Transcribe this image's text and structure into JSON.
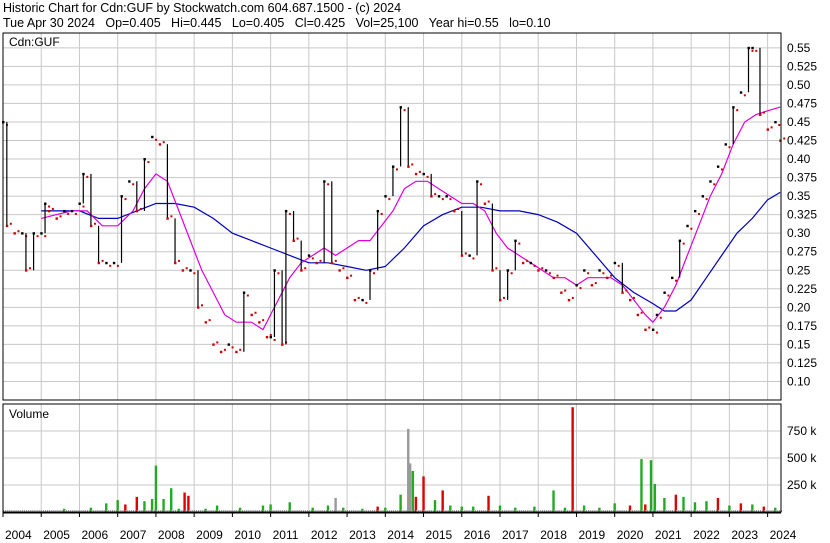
{
  "header": {
    "title": "Historic Chart for Cdn:GUF by Stockwatch.com 604.687.1500 - (c) 2024",
    "quote": "Tue Apr 30 2024   Op=0.405   Hi=0.445   Lo=0.405   Cl=0.425   Vol=25,100   Year hi=0.55   lo=0.10"
  },
  "colors": {
    "grid": "#c8c8c8",
    "frame": "#000000",
    "price_bar": "#000000",
    "price_up": "#000000",
    "price_down": "#cc0000",
    "ma_short": "#dd00dd",
    "ma_long": "#0000bb",
    "vol_up": "#22aa22",
    "vol_down": "#dd0000",
    "vol_flat": "#999999"
  },
  "chart_data": [
    {
      "type": "line",
      "panel": "price",
      "label": "Cdn:GUF",
      "ylim": [
        0.075,
        0.57
      ],
      "yticks": [
        "0.55",
        "0.525",
        "0.50",
        "0.475",
        "0.45",
        "0.425",
        "0.40",
        "0.375",
        "0.35",
        "0.325",
        "0.30",
        "0.275",
        "0.25",
        "0.225",
        "0.20",
        "0.175",
        "0.15",
        "0.125",
        "0.10"
      ],
      "ytick_values": [
        0.55,
        0.525,
        0.5,
        0.475,
        0.45,
        0.425,
        0.4,
        0.375,
        0.35,
        0.325,
        0.3,
        0.275,
        0.25,
        0.225,
        0.2,
        0.175,
        0.15,
        0.125,
        0.1
      ],
      "xlim": [
        2004.0,
        2024.35
      ],
      "grid": true,
      "price_points": [
        [
          2004.0,
          0.45
        ],
        [
          2004.1,
          0.31
        ],
        [
          2004.3,
          0.3
        ],
        [
          2004.5,
          0.3
        ],
        [
          2004.6,
          0.25
        ],
        [
          2004.8,
          0.3
        ],
        [
          2005.0,
          0.3
        ],
        [
          2005.1,
          0.34
        ],
        [
          2005.2,
          0.33
        ],
        [
          2005.4,
          0.32
        ],
        [
          2005.6,
          0.33
        ],
        [
          2005.8,
          0.33
        ],
        [
          2006.0,
          0.34
        ],
        [
          2006.1,
          0.38
        ],
        [
          2006.3,
          0.31
        ],
        [
          2006.5,
          0.26
        ],
        [
          2006.7,
          0.26
        ],
        [
          2006.9,
          0.26
        ],
        [
          2007.1,
          0.35
        ],
        [
          2007.3,
          0.37
        ],
        [
          2007.5,
          0.33
        ],
        [
          2007.7,
          0.4
        ],
        [
          2007.9,
          0.43
        ],
        [
          2008.1,
          0.42
        ],
        [
          2008.3,
          0.32
        ],
        [
          2008.5,
          0.26
        ],
        [
          2008.7,
          0.25
        ],
        [
          2008.9,
          0.25
        ],
        [
          2009.1,
          0.2
        ],
        [
          2009.3,
          0.18
        ],
        [
          2009.5,
          0.15
        ],
        [
          2009.7,
          0.14
        ],
        [
          2009.9,
          0.15
        ],
        [
          2010.1,
          0.14
        ],
        [
          2010.3,
          0.22
        ],
        [
          2010.5,
          0.19
        ],
        [
          2010.7,
          0.18
        ],
        [
          2010.9,
          0.16
        ],
        [
          2011.0,
          0.16
        ],
        [
          2011.1,
          0.25
        ],
        [
          2011.3,
          0.15
        ],
        [
          2011.4,
          0.33
        ],
        [
          2011.6,
          0.29
        ],
        [
          2011.8,
          0.25
        ],
        [
          2012.0,
          0.27
        ],
        [
          2012.2,
          0.26
        ],
        [
          2012.4,
          0.37
        ],
        [
          2012.6,
          0.26
        ],
        [
          2012.8,
          0.25
        ],
        [
          2013.0,
          0.24
        ],
        [
          2013.2,
          0.21
        ],
        [
          2013.4,
          0.21
        ],
        [
          2013.6,
          0.25
        ],
        [
          2013.8,
          0.33
        ],
        [
          2014.0,
          0.35
        ],
        [
          2014.2,
          0.39
        ],
        [
          2014.4,
          0.47
        ],
        [
          2014.6,
          0.39
        ],
        [
          2014.8,
          0.38
        ],
        [
          2015.0,
          0.38
        ],
        [
          2015.2,
          0.35
        ],
        [
          2015.4,
          0.35
        ],
        [
          2015.6,
          0.35
        ],
        [
          2015.8,
          0.33
        ],
        [
          2016.0,
          0.27
        ],
        [
          2016.2,
          0.27
        ],
        [
          2016.4,
          0.37
        ],
        [
          2016.6,
          0.34
        ],
        [
          2016.8,
          0.25
        ],
        [
          2017.0,
          0.21
        ],
        [
          2017.2,
          0.25
        ],
        [
          2017.4,
          0.29
        ],
        [
          2017.6,
          0.26
        ],
        [
          2017.8,
          0.26
        ],
        [
          2018.0,
          0.25
        ],
        [
          2018.2,
          0.25
        ],
        [
          2018.4,
          0.24
        ],
        [
          2018.6,
          0.22
        ],
        [
          2018.8,
          0.21
        ],
        [
          2019.0,
          0.23
        ],
        [
          2019.2,
          0.25
        ],
        [
          2019.4,
          0.23
        ],
        [
          2019.6,
          0.25
        ],
        [
          2019.8,
          0.24
        ],
        [
          2020.0,
          0.26
        ],
        [
          2020.2,
          0.22
        ],
        [
          2020.4,
          0.21
        ],
        [
          2020.6,
          0.19
        ],
        [
          2020.8,
          0.17
        ],
        [
          2021.0,
          0.17
        ],
        [
          2021.1,
          0.19
        ],
        [
          2021.3,
          0.22
        ],
        [
          2021.5,
          0.24
        ],
        [
          2021.7,
          0.29
        ],
        [
          2021.9,
          0.31
        ],
        [
          2022.1,
          0.33
        ],
        [
          2022.3,
          0.35
        ],
        [
          2022.5,
          0.37
        ],
        [
          2022.7,
          0.39
        ],
        [
          2022.9,
          0.42
        ],
        [
          2023.1,
          0.47
        ],
        [
          2023.3,
          0.49
        ],
        [
          2023.5,
          0.55
        ],
        [
          2023.6,
          0.55
        ],
        [
          2023.8,
          0.46
        ],
        [
          2024.0,
          0.44
        ],
        [
          2024.2,
          0.45
        ],
        [
          2024.33,
          0.425
        ]
      ],
      "ma_short": [
        [
          2005.0,
          0.32
        ],
        [
          2005.4,
          0.325
        ],
        [
          2005.8,
          0.33
        ],
        [
          2006.2,
          0.33
        ],
        [
          2006.6,
          0.31
        ],
        [
          2007.0,
          0.31
        ],
        [
          2007.4,
          0.33
        ],
        [
          2007.7,
          0.36
        ],
        [
          2008.0,
          0.38
        ],
        [
          2008.3,
          0.37
        ],
        [
          2008.6,
          0.33
        ],
        [
          2008.9,
          0.29
        ],
        [
          2009.2,
          0.25
        ],
        [
          2009.5,
          0.22
        ],
        [
          2009.8,
          0.19
        ],
        [
          2010.1,
          0.18
        ],
        [
          2010.5,
          0.18
        ],
        [
          2010.8,
          0.17
        ],
        [
          2011.0,
          0.19
        ],
        [
          2011.3,
          0.22
        ],
        [
          2011.5,
          0.24
        ],
        [
          2011.8,
          0.26
        ],
        [
          2012.1,
          0.27
        ],
        [
          2012.4,
          0.28
        ],
        [
          2012.7,
          0.27
        ],
        [
          2013.0,
          0.28
        ],
        [
          2013.3,
          0.29
        ],
        [
          2013.6,
          0.29
        ],
        [
          2013.9,
          0.31
        ],
        [
          2014.2,
          0.33
        ],
        [
          2014.5,
          0.36
        ],
        [
          2014.8,
          0.37
        ],
        [
          2015.1,
          0.37
        ],
        [
          2015.4,
          0.36
        ],
        [
          2015.7,
          0.35
        ],
        [
          2016.0,
          0.34
        ],
        [
          2016.3,
          0.34
        ],
        [
          2016.6,
          0.33
        ],
        [
          2016.9,
          0.3
        ],
        [
          2017.2,
          0.28
        ],
        [
          2017.5,
          0.27
        ],
        [
          2017.8,
          0.26
        ],
        [
          2018.1,
          0.25
        ],
        [
          2018.4,
          0.24
        ],
        [
          2018.7,
          0.24
        ],
        [
          2019.0,
          0.23
        ],
        [
          2019.3,
          0.24
        ],
        [
          2019.6,
          0.24
        ],
        [
          2019.9,
          0.24
        ],
        [
          2020.2,
          0.23
        ],
        [
          2020.5,
          0.21
        ],
        [
          2020.8,
          0.19
        ],
        [
          2021.0,
          0.18
        ],
        [
          2021.3,
          0.2
        ],
        [
          2021.6,
          0.23
        ],
        [
          2021.9,
          0.27
        ],
        [
          2022.2,
          0.31
        ],
        [
          2022.5,
          0.35
        ],
        [
          2022.8,
          0.38
        ],
        [
          2023.1,
          0.42
        ],
        [
          2023.4,
          0.45
        ],
        [
          2023.7,
          0.46
        ],
        [
          2024.0,
          0.465
        ],
        [
          2024.33,
          0.47
        ]
      ],
      "ma_long": [
        [
          2005.0,
          0.33
        ],
        [
          2005.5,
          0.33
        ],
        [
          2006.0,
          0.33
        ],
        [
          2006.5,
          0.32
        ],
        [
          2007.0,
          0.32
        ],
        [
          2007.5,
          0.33
        ],
        [
          2008.0,
          0.34
        ],
        [
          2008.5,
          0.34
        ],
        [
          2009.0,
          0.335
        ],
        [
          2009.5,
          0.32
        ],
        [
          2010.0,
          0.3
        ],
        [
          2010.5,
          0.29
        ],
        [
          2011.0,
          0.28
        ],
        [
          2011.5,
          0.27
        ],
        [
          2012.0,
          0.26
        ],
        [
          2012.5,
          0.26
        ],
        [
          2013.0,
          0.255
        ],
        [
          2013.5,
          0.25
        ],
        [
          2014.0,
          0.255
        ],
        [
          2014.5,
          0.28
        ],
        [
          2015.0,
          0.31
        ],
        [
          2015.5,
          0.325
        ],
        [
          2016.0,
          0.335
        ],
        [
          2016.5,
          0.335
        ],
        [
          2017.0,
          0.33
        ],
        [
          2017.5,
          0.33
        ],
        [
          2018.0,
          0.325
        ],
        [
          2018.5,
          0.315
        ],
        [
          2019.0,
          0.3
        ],
        [
          2019.5,
          0.27
        ],
        [
          2020.0,
          0.24
        ],
        [
          2020.5,
          0.22
        ],
        [
          2021.0,
          0.205
        ],
        [
          2021.3,
          0.195
        ],
        [
          2021.6,
          0.195
        ],
        [
          2022.0,
          0.21
        ],
        [
          2022.4,
          0.24
        ],
        [
          2022.8,
          0.27
        ],
        [
          2023.2,
          0.3
        ],
        [
          2023.6,
          0.32
        ],
        [
          2024.0,
          0.345
        ],
        [
          2024.33,
          0.355
        ]
      ]
    },
    {
      "type": "bar",
      "panel": "volume",
      "label": "Volume",
      "ylim": [
        0,
        1000000
      ],
      "yticks": [
        "750 k",
        "500 k",
        "250 k"
      ],
      "ytick_values": [
        750000,
        500000,
        250000
      ],
      "xlim": [
        2004.0,
        2024.35
      ],
      "xticks": [
        "2004",
        "2005",
        "2006",
        "2007",
        "2008",
        "2009",
        "2010",
        "2011",
        "2012",
        "2013",
        "2014",
        "2015",
        "2016",
        "2017",
        "2018",
        "2019",
        "2020",
        "2021",
        "2022",
        "2023",
        "2024"
      ],
      "xtick_values": [
        2004,
        2005,
        2006,
        2007,
        2008,
        2009,
        2010,
        2011,
        2012,
        2013,
        2014,
        2015,
        2016,
        2017,
        2018,
        2019,
        2020,
        2021,
        2022,
        2023,
        2024
      ],
      "bars": [
        [
          2005.6,
          30000,
          "up"
        ],
        [
          2006.3,
          40000,
          "up"
        ],
        [
          2006.7,
          80000,
          "up"
        ],
        [
          2007.0,
          110000,
          "up"
        ],
        [
          2007.2,
          70000,
          "down"
        ],
        [
          2007.5,
          140000,
          "down"
        ],
        [
          2007.7,
          100000,
          "up"
        ],
        [
          2007.9,
          120000,
          "up"
        ],
        [
          2008.0,
          430000,
          "up"
        ],
        [
          2008.2,
          120000,
          "up"
        ],
        [
          2008.4,
          220000,
          "up"
        ],
        [
          2008.6,
          30000,
          "up"
        ],
        [
          2008.75,
          180000,
          "down"
        ],
        [
          2008.85,
          150000,
          "down"
        ],
        [
          2009.3,
          30000,
          "up"
        ],
        [
          2009.6,
          60000,
          "up"
        ],
        [
          2010.2,
          40000,
          "up"
        ],
        [
          2010.8,
          60000,
          "up"
        ],
        [
          2011.0,
          70000,
          "up"
        ],
        [
          2011.5,
          90000,
          "up"
        ],
        [
          2012.1,
          40000,
          "up"
        ],
        [
          2012.5,
          60000,
          "up"
        ],
        [
          2012.7,
          130000,
          "flat"
        ],
        [
          2012.9,
          40000,
          "up"
        ],
        [
          2013.4,
          30000,
          "up"
        ],
        [
          2013.8,
          50000,
          "down"
        ],
        [
          2014.0,
          40000,
          "up"
        ],
        [
          2014.4,
          160000,
          "up"
        ],
        [
          2014.6,
          770000,
          "flat"
        ],
        [
          2014.65,
          450000,
          "flat"
        ],
        [
          2014.72,
          380000,
          "up"
        ],
        [
          2014.8,
          140000,
          "down"
        ],
        [
          2015.0,
          330000,
          "down"
        ],
        [
          2015.3,
          110000,
          "up"
        ],
        [
          2015.5,
          200000,
          "down"
        ],
        [
          2015.7,
          60000,
          "up"
        ],
        [
          2016.0,
          50000,
          "up"
        ],
        [
          2016.3,
          50000,
          "up"
        ],
        [
          2016.7,
          150000,
          "down"
        ],
        [
          2017.0,
          60000,
          "up"
        ],
        [
          2017.4,
          40000,
          "up"
        ],
        [
          2017.9,
          50000,
          "up"
        ],
        [
          2018.4,
          200000,
          "up"
        ],
        [
          2018.7,
          40000,
          "up"
        ],
        [
          2018.9,
          970000,
          "down"
        ],
        [
          2019.2,
          60000,
          "up"
        ],
        [
          2019.6,
          40000,
          "up"
        ],
        [
          2020.0,
          80000,
          "up"
        ],
        [
          2020.4,
          60000,
          "down"
        ],
        [
          2020.7,
          490000,
          "up"
        ],
        [
          2020.8,
          70000,
          "down"
        ],
        [
          2020.95,
          480000,
          "up"
        ],
        [
          2021.05,
          260000,
          "up"
        ],
        [
          2021.3,
          130000,
          "up"
        ],
        [
          2021.6,
          160000,
          "down"
        ],
        [
          2021.8,
          140000,
          "up"
        ],
        [
          2022.1,
          90000,
          "up"
        ],
        [
          2022.4,
          100000,
          "up"
        ],
        [
          2022.7,
          130000,
          "down"
        ],
        [
          2023.0,
          60000,
          "up"
        ],
        [
          2023.3,
          80000,
          "down"
        ],
        [
          2023.6,
          70000,
          "up"
        ],
        [
          2023.9,
          50000,
          "down"
        ],
        [
          2024.2,
          40000,
          "up"
        ]
      ]
    }
  ]
}
